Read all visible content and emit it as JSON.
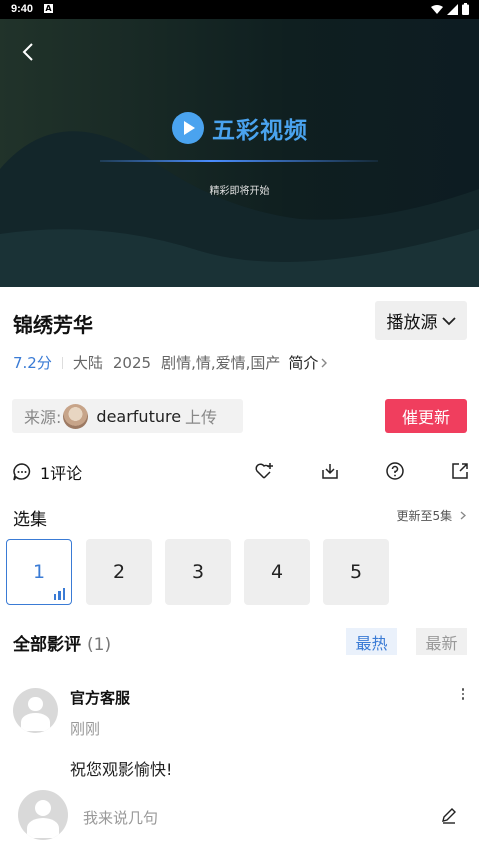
{
  "status_bar": {
    "time": "9:40",
    "notif": "A"
  },
  "player": {
    "brand": "五彩视频",
    "loading_text": "精彩即将开始"
  },
  "show": {
    "title": "锦绣芳华",
    "source_button": "播放源",
    "score": "7.2分",
    "region": "大陆",
    "year": "2025",
    "genres": "剧情,情,爱情,国产",
    "intro_link": "简介"
  },
  "uploader": {
    "label": "来源:",
    "name": "dearfuture",
    "suffix": "上传"
  },
  "urge_button": "催更新",
  "actions": {
    "comments": "1评论"
  },
  "episodes": {
    "heading": "选集",
    "update_to": "更新至5集",
    "items": [
      "1",
      "2",
      "3",
      "4",
      "5"
    ],
    "active_index": 0
  },
  "reviews": {
    "heading": "全部影评",
    "count": "(1)",
    "sort_hot": "最热",
    "sort_new": "最新",
    "items": [
      {
        "user": "官方客服",
        "time": "刚刚",
        "text": "祝您观影愉快!"
      }
    ]
  },
  "reply": {
    "placeholder": "我来说几句"
  },
  "colors": {
    "accent": "#3a7bd5",
    "urge": "#f03e5e",
    "brand": "#4aa3ef"
  }
}
